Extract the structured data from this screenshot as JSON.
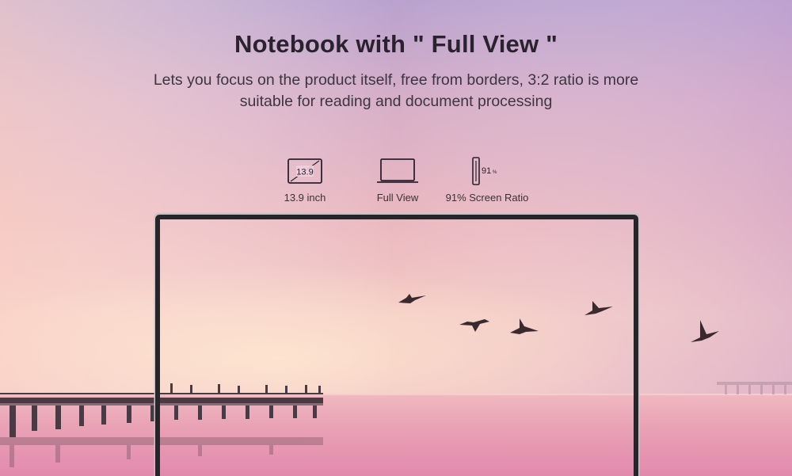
{
  "headline": "Notebook with \" Full View \"",
  "subheadline_line1": "Lets you focus on the product itself, free from borders, 3:2 ratio is more",
  "subheadline_line2": "suitable for reading and document processing",
  "features": [
    {
      "icon": "screen-size-icon",
      "icon_text": "13.9",
      "label": "13.9 inch"
    },
    {
      "icon": "laptop-icon",
      "label": "Full View"
    },
    {
      "icon": "screen-ratio-icon",
      "icon_text": "91",
      "icon_unit": "%",
      "label": "91% Screen Ratio"
    }
  ],
  "colors": {
    "sky_top": "#b9a3cf",
    "sky_mid": "#e6b2c0",
    "horizon": "#f2c6c2",
    "water": "#e59ab2",
    "bezel": "#2a2a2e",
    "text": "#2b2230"
  }
}
